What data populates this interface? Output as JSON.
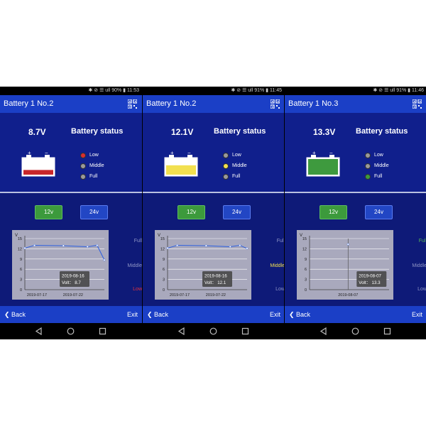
{
  "colors": {
    "low_red": "#d92e2e",
    "middle_yellow": "#f2e04f",
    "full_green": "#3c9a3c",
    "app_bar": "#1b3fc6",
    "background": "#0e1a78"
  },
  "labels": {
    "battery_status": "Battery status",
    "low": "Low",
    "middle": "Middle",
    "full": "Full",
    "btn_12": "12v",
    "btn_24": "24v",
    "back": "Back",
    "exit": "Exit",
    "zone_full": "Full",
    "zone_middle": "Middle",
    "zone_low": "Low",
    "volt_unit": "V",
    "volt_label": "Volt："
  },
  "icons": {
    "qr": "qr-code-icon",
    "back": "chevron-left-icon",
    "nav_back": "triangle-back-icon",
    "nav_home": "circle-home-icon",
    "nav_recent": "square-recent-icon",
    "battery": "battery-icon"
  },
  "screens": [
    {
      "status_bar": "✱ ⊘ ☰ ull 90% ▮ 11:53",
      "title": "Battery 1 No.2",
      "voltage": "8.7V",
      "level": "low",
      "fill_fraction": 0.3,
      "fill_color": "#c8262a",
      "zone_highlight": "low",
      "tooltip": {
        "date": "2019-08-16",
        "volt": "8.7"
      },
      "chart_data": {
        "type": "line",
        "ylabel": "V",
        "ylim": [
          0,
          15
        ],
        "yticks": [
          0,
          3,
          6,
          9,
          12,
          15
        ],
        "xlim": [
          0,
          33
        ],
        "x": [
          0,
          4,
          16,
          26,
          30,
          33
        ],
        "values": [
          12.2,
          13.0,
          12.9,
          12.6,
          13.0,
          8.7
        ],
        "xticks": [
          {
            "x": 5,
            "label": "2019-07-17"
          },
          {
            "x": 20,
            "label": "2019-07-22"
          }
        ],
        "cursor_x": null
      }
    },
    {
      "status_bar": "✱ ⊘ ☰ ull 91% ▮ 11:45",
      "title": "Battery 1 No.2",
      "voltage": "12.1V",
      "level": "middle",
      "fill_fraction": 0.6,
      "fill_color": "#f2e04f",
      "zone_highlight": "middle",
      "tooltip": {
        "date": "2019-08-16",
        "volt": "12.1"
      },
      "chart_data": {
        "type": "line",
        "ylabel": "V",
        "ylim": [
          0,
          15
        ],
        "yticks": [
          0,
          3,
          6,
          9,
          12,
          15
        ],
        "xlim": [
          0,
          33
        ],
        "x": [
          0,
          4,
          16,
          26,
          30,
          33
        ],
        "values": [
          12.2,
          13.0,
          12.9,
          12.6,
          13.0,
          12.1
        ],
        "xticks": [
          {
            "x": 5,
            "label": "2019-07-17"
          },
          {
            "x": 20,
            "label": "2019-07-22"
          }
        ],
        "cursor_x": null
      }
    },
    {
      "status_bar": "✱ ⊘ ☰ ull 91% ▮ 11:46",
      "title": "Battery 1 No.3",
      "voltage": "13.3V",
      "level": "full",
      "fill_fraction": 1.0,
      "fill_color": "#3e9a3e",
      "zone_highlight": "full",
      "tooltip": {
        "date": "2019-08-07",
        "volt": "13.3"
      },
      "chart_data": {
        "type": "line",
        "ylabel": "V",
        "ylim": [
          0,
          15
        ],
        "yticks": [
          0,
          3,
          6,
          9,
          12,
          15
        ],
        "xlim": [
          0,
          33
        ],
        "x": [
          16
        ],
        "values": [
          13.3
        ],
        "xticks": [
          {
            "x": 16,
            "label": "2019-08-07"
          }
        ],
        "cursor_x": 16
      }
    }
  ]
}
